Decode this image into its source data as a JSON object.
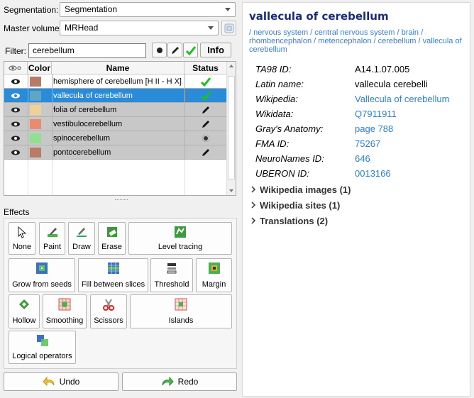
{
  "segmentation": {
    "label": "Segmentation:",
    "value": "Segmentation"
  },
  "master_volume": {
    "label": "Master volume:",
    "value": "MRHead"
  },
  "filter": {
    "label": "Filter:",
    "value": "cerebellum",
    "info_label": "Info"
  },
  "table": {
    "headers": {
      "visibility": "",
      "color": "Color",
      "name": "Name",
      "status": "Status"
    },
    "rows": [
      {
        "name": "hemisphere of cerebellum [H II - H X]",
        "color": "#b77b68",
        "status": "check"
      },
      {
        "name": "vallecula of cerebellum",
        "color": "#5fa6c6",
        "status": "check"
      },
      {
        "name": "folia of cerebellum",
        "color": "#f0d299",
        "status": "pencil"
      },
      {
        "name": "vestibulocerebellum",
        "color": "#e88b6e",
        "status": "pencil"
      },
      {
        "name": "spinocerebellum",
        "color": "#90e090",
        "status": "dot"
      },
      {
        "name": "pontocerebellum",
        "color": "#b77b68",
        "status": "pencil"
      }
    ]
  },
  "effects": {
    "title": "Effects",
    "buttons": [
      "None",
      "Paint",
      "Draw",
      "Erase",
      "Level tracing",
      "Grow from seeds",
      "Fill between slices",
      "Threshold",
      "Margin",
      "Hollow",
      "Smoothing",
      "Scissors",
      "Islands",
      "Logical operators"
    ]
  },
  "undo_label": "Undo",
  "redo_label": "Redo",
  "info": {
    "title": "vallecula of cerebellum",
    "breadcrumb": " / nervous system / central nervous system / brain / rhombencephalon / metencephalon / cerebellum / vallecula of cerebellum",
    "rows": [
      {
        "key": "TA98 ID:",
        "value": "A14.1.07.005",
        "link": false
      },
      {
        "key": "Latin name:",
        "value": "vallecula cerebelli",
        "link": false
      },
      {
        "key": "Wikipedia:",
        "value": "Vallecula of cerebellum",
        "link": true
      },
      {
        "key": "Wikidata:",
        "value": "Q7911911",
        "link": true
      },
      {
        "key": "Gray's Anatomy:",
        "value": "page 788",
        "link": true
      },
      {
        "key": "FMA ID:",
        "value": "75267",
        "link": true
      },
      {
        "key": "NeuroNames ID:",
        "value": "646",
        "link": true
      },
      {
        "key": "UBERON ID:",
        "value": "0013166",
        "link": true
      }
    ],
    "sections": [
      "Wikipedia images (1)",
      "Wikipedia sites (1)",
      "Translations (2)"
    ]
  }
}
